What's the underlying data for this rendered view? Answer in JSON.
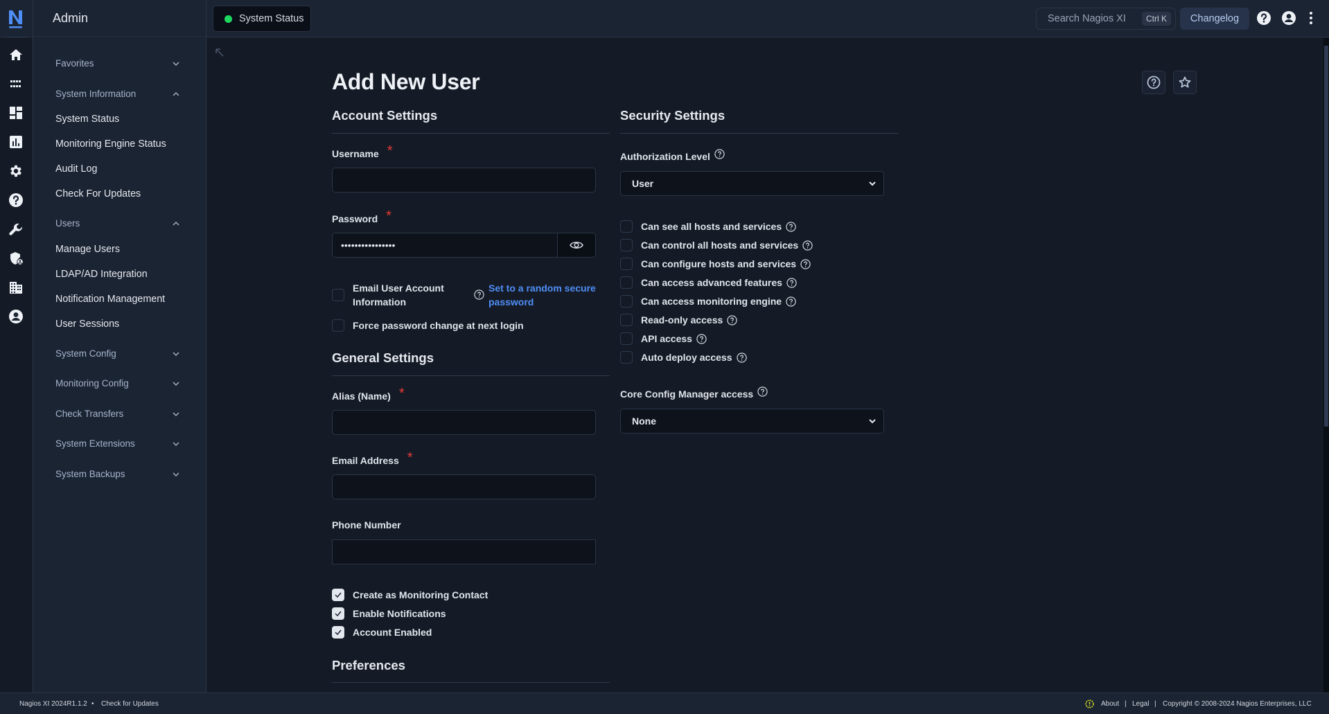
{
  "header": {
    "app_section": "Admin",
    "system_status_label": "System Status",
    "system_status_color": "#1ed75f",
    "search_placeholder": "Search Nagios XI",
    "search_shortcut": "Ctrl K",
    "changelog_label": "Changelog"
  },
  "icon_rail": [
    {
      "name": "home-icon"
    },
    {
      "name": "apps-grid-icon"
    },
    {
      "name": "dashboard-icon"
    },
    {
      "name": "reports-chart-icon"
    },
    {
      "name": "gear-icon"
    },
    {
      "name": "help-icon"
    },
    {
      "name": "wrench-icon"
    },
    {
      "name": "shield-user-icon"
    },
    {
      "name": "building-icon"
    },
    {
      "name": "account-icon"
    }
  ],
  "sidebar": {
    "groups": [
      {
        "label": "Favorites",
        "expanded": false,
        "items": []
      },
      {
        "label": "System Information",
        "expanded": true,
        "items": [
          "System Status",
          "Monitoring Engine Status",
          "Audit Log",
          "Check For Updates"
        ]
      },
      {
        "label": "Users",
        "expanded": true,
        "items": [
          "Manage Users",
          "LDAP/AD Integration",
          "Notification Management",
          "User Sessions"
        ]
      },
      {
        "label": "System Config",
        "expanded": false,
        "items": []
      },
      {
        "label": "Monitoring Config",
        "expanded": false,
        "items": []
      },
      {
        "label": "Check Transfers",
        "expanded": false,
        "items": []
      },
      {
        "label": "System Extensions",
        "expanded": false,
        "items": []
      },
      {
        "label": "System Backups",
        "expanded": false,
        "items": []
      }
    ]
  },
  "page": {
    "title": "Add New User",
    "account_settings": {
      "title": "Account Settings",
      "username_label": "Username",
      "username_value": "",
      "password_label": "Password",
      "password_value": "••••••••••••••••",
      "email_user_label": "Email User Account Information",
      "email_user_checked": false,
      "random_password_link": "Set to a random secure password",
      "force_change_label": "Force password change at next login",
      "force_change_checked": false
    },
    "general_settings": {
      "title": "General Settings",
      "alias_label": "Alias (Name)",
      "alias_value": "",
      "email_label": "Email Address",
      "email_value": "",
      "phone_label": "Phone Number",
      "phone_value": "",
      "checkboxes": [
        {
          "label": "Create as Monitoring Contact",
          "checked": true
        },
        {
          "label": "Enable Notifications",
          "checked": true
        },
        {
          "label": "Account Enabled",
          "checked": true
        }
      ]
    },
    "preferences": {
      "title": "Preferences"
    },
    "security_settings": {
      "title": "Security Settings",
      "auth_level_label": "Authorization Level",
      "auth_level_value": "User",
      "permissions": [
        {
          "label": "Can see all hosts and services",
          "checked": false
        },
        {
          "label": "Can control all hosts and services",
          "checked": false
        },
        {
          "label": "Can configure hosts and services",
          "checked": false
        },
        {
          "label": "Can access advanced features",
          "checked": false
        },
        {
          "label": "Can access monitoring engine",
          "checked": false
        },
        {
          "label": "Read-only access",
          "checked": false
        },
        {
          "label": "API access",
          "checked": false
        },
        {
          "label": "Auto deploy access",
          "checked": false
        }
      ],
      "ccm_label": "Core Config Manager access",
      "ccm_value": "None"
    }
  },
  "footer": {
    "version": "Nagios XI 2024R1.1.2",
    "separator": "•",
    "check_updates": "Check for Updates",
    "about": "About",
    "legal": "Legal",
    "pipe": "|",
    "copyright": "Copyright © 2008-2024 Nagios Enterprises, LLC"
  },
  "colors": {
    "accent": "#4f8ef7",
    "required": "#e53935",
    "footer_alert": "#d4d62a"
  }
}
